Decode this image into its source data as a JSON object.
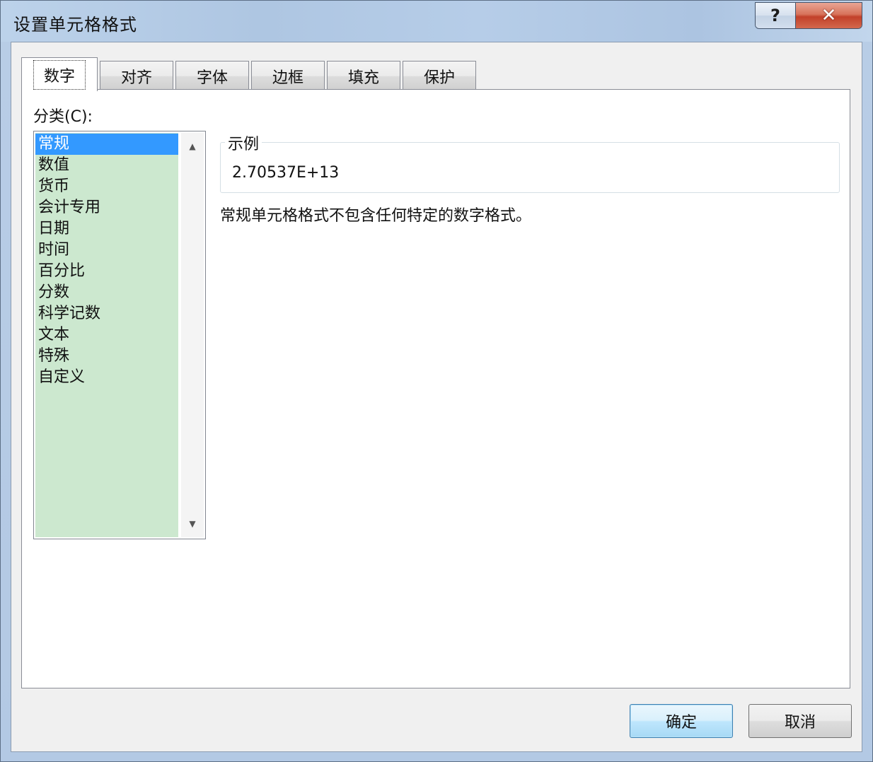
{
  "window": {
    "title": "设置单元格格式",
    "help_glyph": "?",
    "close_glyph": "✕"
  },
  "tabs": [
    {
      "label": "数字",
      "active": true
    },
    {
      "label": "对齐",
      "active": false
    },
    {
      "label": "字体",
      "active": false
    },
    {
      "label": "边框",
      "active": false
    },
    {
      "label": "填充",
      "active": false
    },
    {
      "label": "保护",
      "active": false
    }
  ],
  "category": {
    "label": "分类(C):",
    "items": [
      "常规",
      "数值",
      "货币",
      "会计专用",
      "日期",
      "时间",
      "百分比",
      "分数",
      "科学记数",
      "文本",
      "特殊",
      "自定义"
    ],
    "selected": "常规"
  },
  "sample": {
    "legend": "示例",
    "value": "2.70537E+13"
  },
  "description": "常规单元格格式不包含任何特定的数字格式。",
  "buttons": {
    "ok": "确定",
    "cancel": "取消"
  },
  "colors": {
    "list_background": "#cce8cf",
    "selection": "#3399ff",
    "close_button": "#c2412a"
  },
  "icons": {
    "scroll_up": "▲",
    "scroll_down": "▼"
  }
}
